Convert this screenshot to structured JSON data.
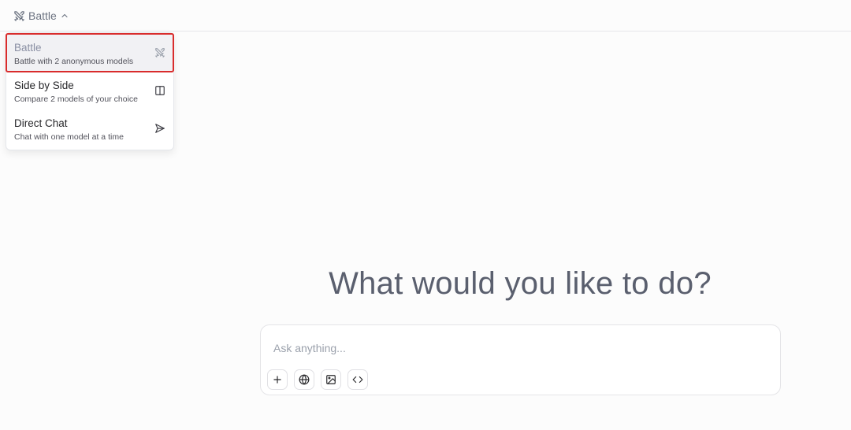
{
  "header": {
    "mode_label": "Battle",
    "mode_icon": "swords-icon",
    "chevron_icon": "chevron-up-icon"
  },
  "menu": {
    "items": [
      {
        "title": "Battle",
        "description": "Battle with 2 anonymous models",
        "icon": "swords-icon",
        "selected": true
      },
      {
        "title": "Side by Side",
        "description": "Compare 2 models of your choice",
        "icon": "columns-icon",
        "selected": false
      },
      {
        "title": "Direct Chat",
        "description": "Chat with one model at a time",
        "icon": "send-icon",
        "selected": false
      }
    ]
  },
  "hero": {
    "title": "What would you like to do?"
  },
  "chat": {
    "placeholder": "Ask anything...",
    "value": "",
    "tools": [
      {
        "name": "add-attachment",
        "icon": "plus-icon"
      },
      {
        "name": "web-search",
        "icon": "globe-icon"
      },
      {
        "name": "image-generation",
        "icon": "image-icon"
      },
      {
        "name": "code",
        "icon": "code-icon"
      }
    ]
  },
  "colors": {
    "selected_outline": "#d92c2c",
    "selected_bg": "#f1f1f4",
    "muted_text": "#6b7280",
    "hero_text": "#5a5f6e"
  }
}
